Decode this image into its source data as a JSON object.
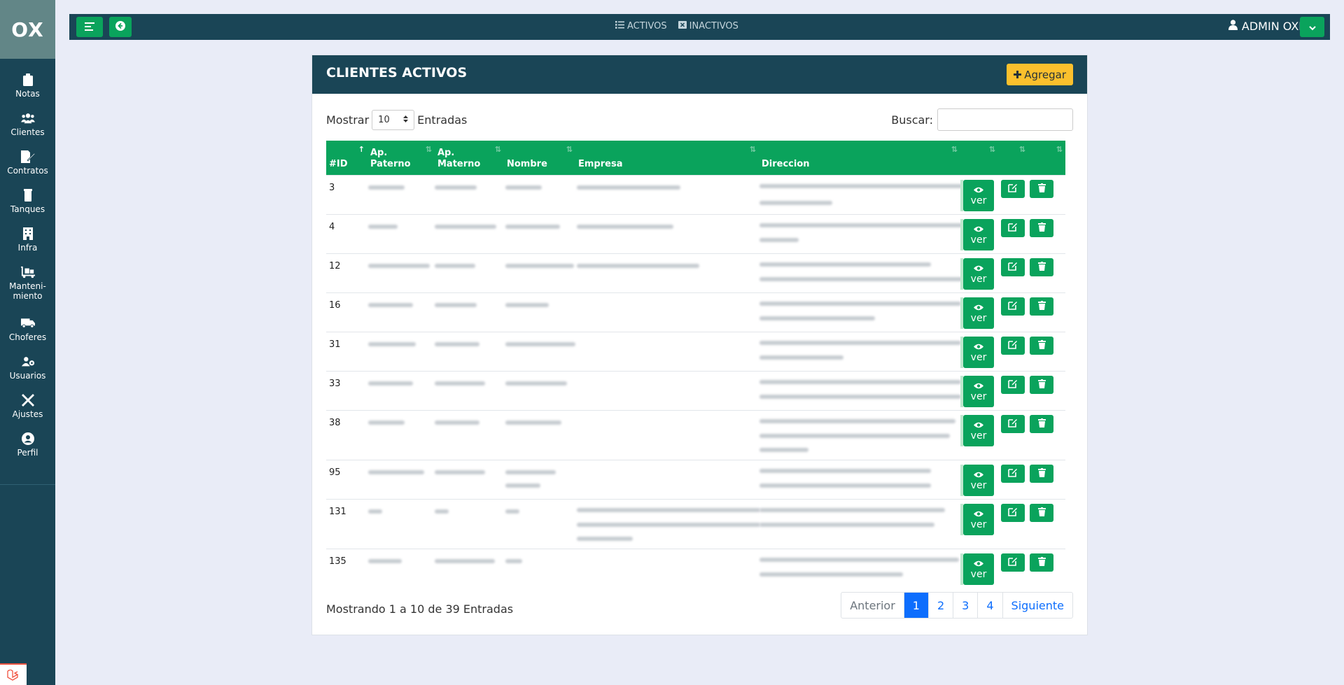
{
  "brand": "OX",
  "sidebar": {
    "items": [
      {
        "label": "Notas",
        "icon": "clipboard-icon"
      },
      {
        "label": "Clientes",
        "icon": "users-icon"
      },
      {
        "label": "Contratos",
        "icon": "file-signature-icon"
      },
      {
        "label": "Tanques",
        "icon": "tank-icon"
      },
      {
        "label": "Infra",
        "icon": "building-icon"
      },
      {
        "label": "Manteni-\nmiento",
        "icon": "dolly-icon"
      },
      {
        "label": "Choferes",
        "icon": "truck-icon"
      },
      {
        "label": "Usuarios",
        "icon": "users-cog-icon"
      },
      {
        "label": "Ajustes",
        "icon": "tools-icon"
      },
      {
        "label": "Perfil",
        "icon": "user-circle-icon"
      }
    ]
  },
  "topbar": {
    "activos": "ACTIVOS",
    "inactivos": "INACTIVOS",
    "user": "ADMIN OXI"
  },
  "card": {
    "title": "CLIENTES ACTIVOS",
    "add_label": "Agregar",
    "show_label": "Mostrar",
    "page_length": "10",
    "entries_label": "Entradas",
    "search_label": "Buscar:",
    "search_value": ""
  },
  "table": {
    "columns": [
      "#ID",
      "Ap.\nPaterno",
      "Ap.\nMaterno",
      "Nombre",
      "Empresa",
      "Direccion"
    ],
    "ver_label": "ver",
    "rows": [
      {
        "id": "3"
      },
      {
        "id": "4"
      },
      {
        "id": "12"
      },
      {
        "id": "16"
      },
      {
        "id": "31"
      },
      {
        "id": "33"
      },
      {
        "id": "38"
      },
      {
        "id": "95"
      },
      {
        "id": "131"
      },
      {
        "id": "135"
      }
    ]
  },
  "footer": {
    "info": "Mostrando 1 a 10 de 39 Entradas",
    "pages": [
      "Anterior",
      "1",
      "2",
      "3",
      "4",
      "Siguiente"
    ],
    "active_page": "1"
  },
  "colors": {
    "sidebar": "#1a4556",
    "accent_green": "#0aa35c",
    "add_button": "#fbc02d",
    "page_active": "#0d6efd"
  }
}
